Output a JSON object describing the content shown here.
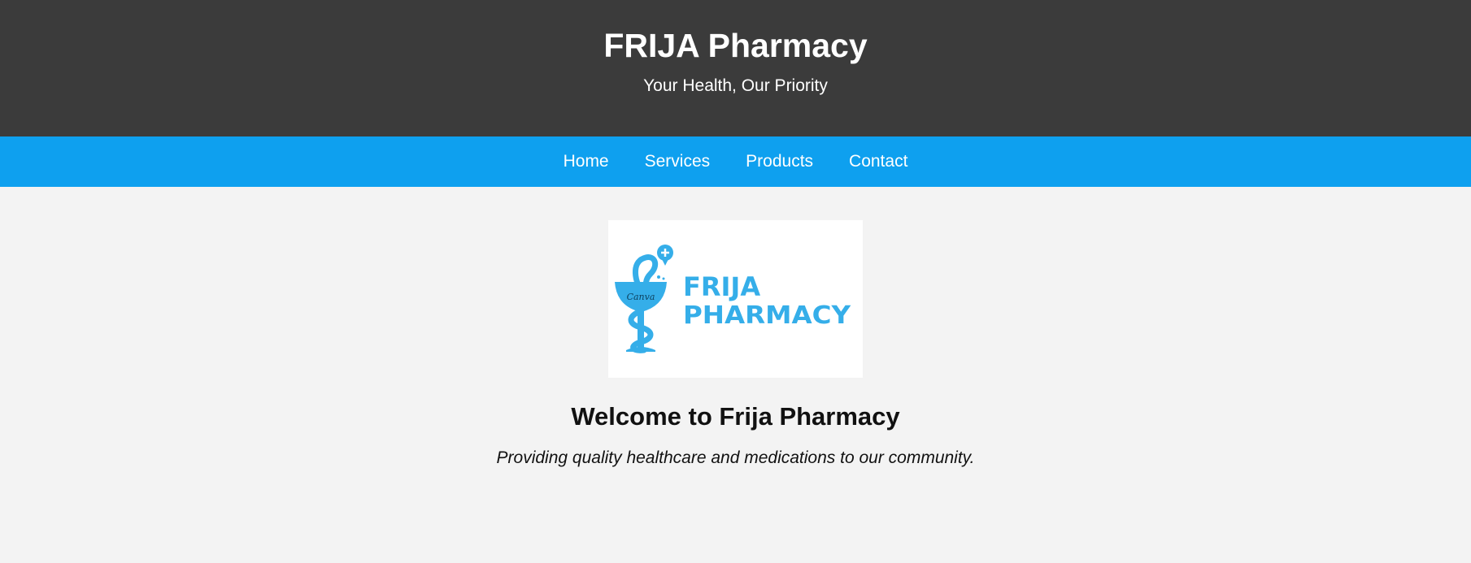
{
  "header": {
    "title": "FRIJA Pharmacy",
    "tagline": "Your Health, Our Priority"
  },
  "nav": {
    "items": [
      {
        "label": "Home"
      },
      {
        "label": "Services"
      },
      {
        "label": "Products"
      },
      {
        "label": "Contact"
      }
    ]
  },
  "main": {
    "logo": {
      "line1": "FRIJA",
      "line2": "PHARMACY",
      "watermark": "Canva",
      "icon": "caduceus-bowl-of-hygieia-icon"
    },
    "welcome_heading": "Welcome to Frija Pharmacy",
    "intro_text": "Providing quality healthcare and medications to our community."
  },
  "colors": {
    "header_bg": "#3b3b3b",
    "nav_bg": "#0ea0ef",
    "page_bg": "#f3f3f3",
    "logo_blue": "#35aee9"
  }
}
